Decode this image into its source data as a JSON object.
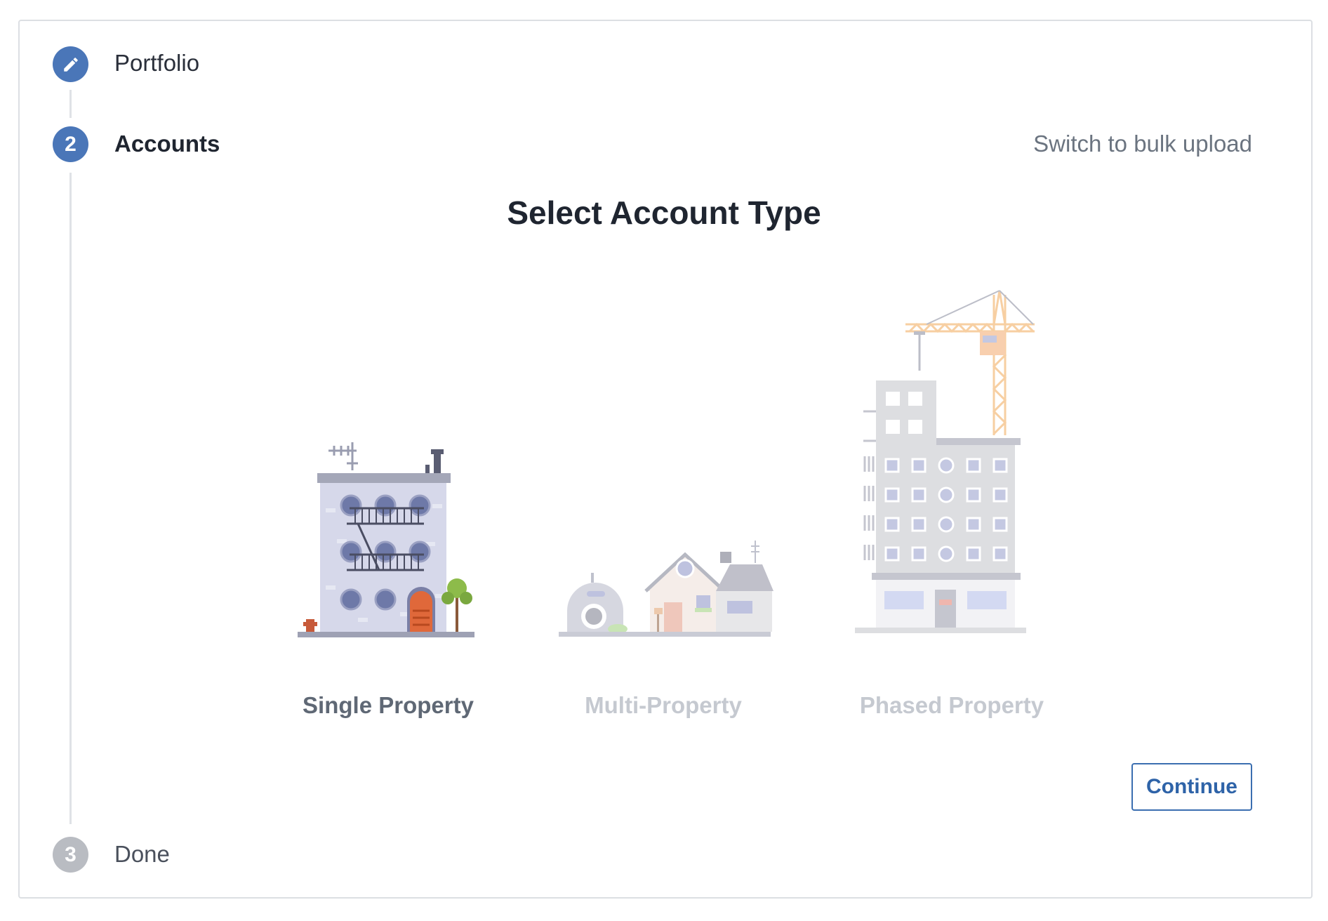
{
  "steps": [
    {
      "number": "",
      "label": "Portfolio",
      "icon": "pencil-icon",
      "state": "completed"
    },
    {
      "number": "2",
      "label": "Accounts",
      "state": "active"
    },
    {
      "number": "3",
      "label": "Done",
      "state": "pending"
    }
  ],
  "header": {
    "bulk_upload_link": "Switch to bulk upload"
  },
  "main": {
    "title": "Select Account Type",
    "options": [
      {
        "label": "Single Property",
        "icon": "apartment-building-icon",
        "selected": true
      },
      {
        "label": "Multi-Property",
        "icon": "houses-icon",
        "selected": false
      },
      {
        "label": "Phased Property",
        "icon": "construction-building-icon",
        "selected": false
      }
    ],
    "continue_label": "Continue"
  },
  "colors": {
    "accent": "#4a76b8",
    "step_pending": "#b9bcc2",
    "label_selected": "#5f6875",
    "label_unselected": "#c5c9d0",
    "button": "#2e63a8"
  }
}
